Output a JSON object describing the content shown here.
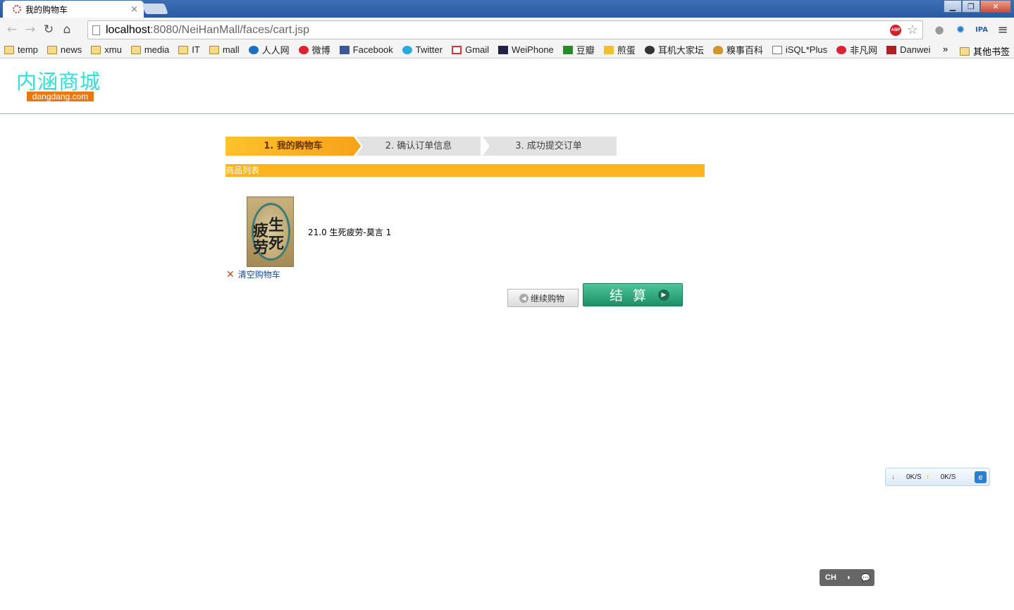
{
  "browser": {
    "tab_title": "我的购物车",
    "tab_close": "×",
    "url_host": "localhost",
    "url_path": ":8080/NeiHanMall/faces/cart.jsp",
    "window_controls": {
      "minimize": "▁",
      "restore": "❐",
      "close": "✕"
    },
    "nav": {
      "back": "←",
      "forward": "→",
      "reload": "↻",
      "home": "⌂"
    },
    "abp_label": "ABP",
    "star": "☆",
    "menu": "≡"
  },
  "bookmarks": [
    {
      "label": "temp",
      "icon": "folder-icon"
    },
    {
      "label": "news",
      "icon": "folder-icon"
    },
    {
      "label": "xmu",
      "icon": "folder-icon"
    },
    {
      "label": "media",
      "icon": "folder-icon"
    },
    {
      "label": "IT",
      "icon": "folder-icon"
    },
    {
      "label": "mall",
      "icon": "folder-icon"
    },
    {
      "label": "人人网",
      "icon": "renren-icon"
    },
    {
      "label": "微博",
      "icon": "weibo-icon"
    },
    {
      "label": "Facebook",
      "icon": "facebook-icon"
    },
    {
      "label": "Twitter",
      "icon": "twitter-icon"
    },
    {
      "label": "Gmail",
      "icon": "gmail-icon"
    },
    {
      "label": "WeiPhone",
      "icon": "weiphone-icon"
    },
    {
      "label": "豆瓣",
      "icon": "douban-icon"
    },
    {
      "label": "煎蛋",
      "icon": "jandan-icon"
    },
    {
      "label": "耳机大家坛",
      "icon": "face-icon"
    },
    {
      "label": "糗事百科",
      "icon": "qiushi-icon"
    },
    {
      "label": "iSQL*Plus",
      "icon": "document-icon"
    },
    {
      "label": "非凡网",
      "icon": "feifan-icon"
    },
    {
      "label": "Danwei",
      "icon": "danwei-icon"
    }
  ],
  "bookmarks_more": "»",
  "bookmarks_other": "其他书签",
  "site": {
    "logo_cn": "内涵商城",
    "logo_en": "dangdang.com"
  },
  "steps": {
    "step1": "1. 我的购物车",
    "step2": "2. 确认订单信息",
    "step3": "3. 成功提交订单"
  },
  "section_title": "商品列表",
  "cart_item": {
    "text": "21.0 生死疲劳-莫言 1",
    "cover_glyphs": [
      "生",
      "死",
      "疲",
      "劳"
    ]
  },
  "clear_cart": {
    "icon": "✕",
    "label": "清空购物车"
  },
  "continue_button": {
    "icon": "◀",
    "label": "继续购物"
  },
  "checkout_button": {
    "label": "结算",
    "icon": "▶"
  },
  "speed_widget": {
    "down_icon": "↓",
    "down": "0K/S",
    "up_icon": "↑",
    "up": "0K/S",
    "ie": "e"
  },
  "ime_widget": {
    "lang": "CH",
    "mode": "◖",
    "chat": "💬"
  }
}
